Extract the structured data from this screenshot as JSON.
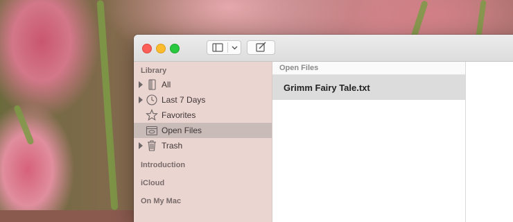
{
  "sidebar": {
    "library_header": "Library",
    "items": [
      {
        "label": "All",
        "icon": "document-stack-icon",
        "expandable": true
      },
      {
        "label": "Last 7 Days",
        "icon": "clock-icon",
        "expandable": true
      },
      {
        "label": "Favorites",
        "icon": "star-icon",
        "expandable": false
      },
      {
        "label": "Open Files",
        "icon": "folder-icon",
        "expandable": false,
        "selected": true
      },
      {
        "label": "Trash",
        "icon": "trash-icon",
        "expandable": true
      }
    ],
    "sections": [
      "Introduction",
      "iCloud",
      "On My Mac"
    ]
  },
  "list": {
    "header": "Open Files",
    "items": [
      {
        "name": "Grimm Fairy Tale.txt",
        "selected": true
      }
    ]
  },
  "colors": {
    "close": "#fc5f57",
    "minimize": "#fdbc2e",
    "zoom": "#28c840",
    "selection": "#dcdcdc"
  }
}
